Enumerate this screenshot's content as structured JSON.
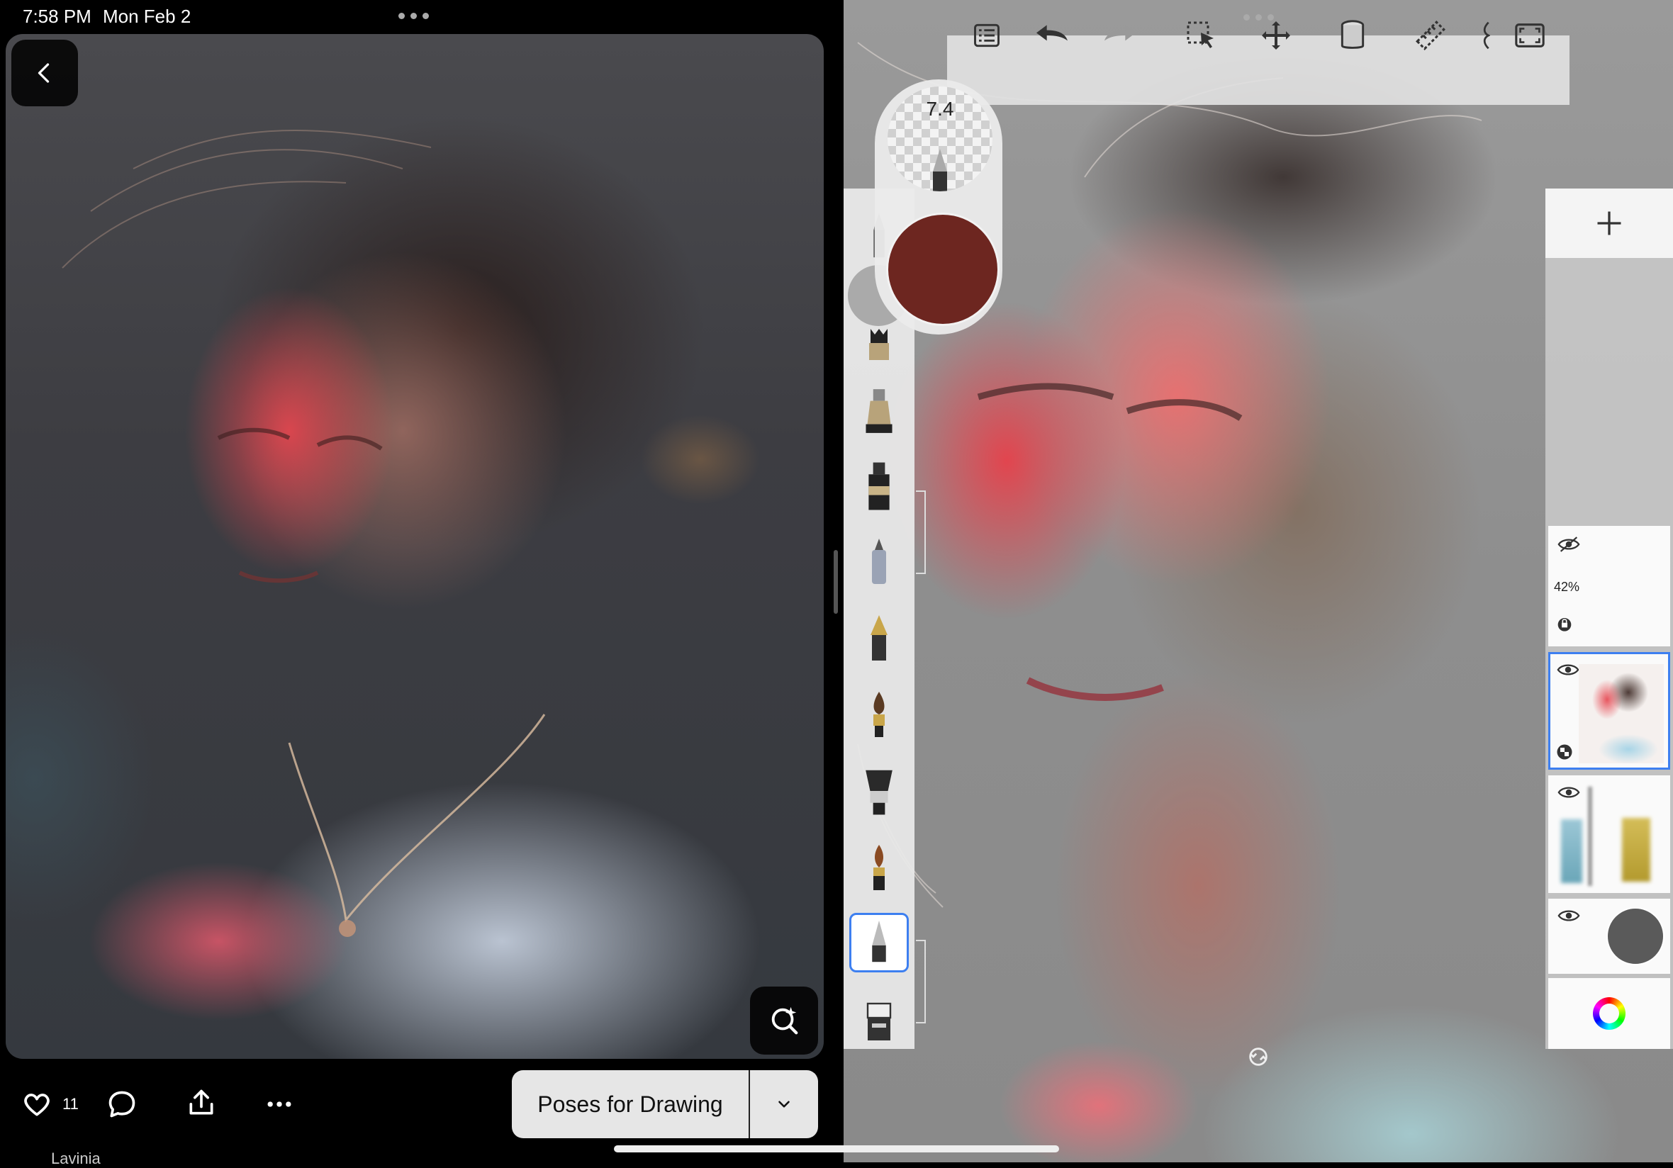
{
  "status_bar": {
    "time": "7:58 PM",
    "date": "Mon Feb 2"
  },
  "pin_viewer": {
    "like_count": "11",
    "board_button_label": "Poses for Drawing",
    "author_name": "Lavinia",
    "icons": [
      "chevron-left-icon",
      "visual-search-icon",
      "heart-icon",
      "comment-icon",
      "share-icon",
      "more-icon",
      "chevron-down-icon"
    ]
  },
  "sketch_app": {
    "brush_size": "7.4",
    "current_color": "#6d2620",
    "accent_color": "#3d7ff0",
    "layer_opacity": "42%",
    "toolbar_icons": [
      "list-icon",
      "undo-icon",
      "redo-icon",
      "selection-icon",
      "transform-icon",
      "fill-icon",
      "ruler-icon",
      "perspective-icon",
      "fullscreen-icon"
    ],
    "brushes": [
      "pencil",
      "marker",
      "ink-pen",
      "felt-tip",
      "fountain-pen",
      "round-brush",
      "fan-brush",
      "flat-brush",
      "airbrush",
      "eraser"
    ]
  }
}
